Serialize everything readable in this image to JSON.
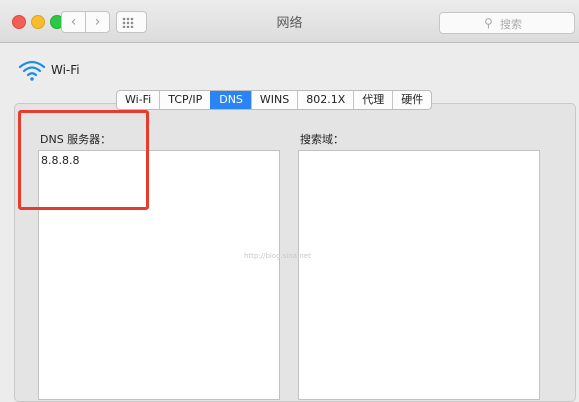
{
  "window": {
    "title": "网络"
  },
  "toolbar": {
    "back_icon": "chevron-left",
    "back_glyph": "‹",
    "forward_icon": "chevron-right",
    "forward_glyph": "›",
    "grid_icon": "grid-dots"
  },
  "search": {
    "icon": "magnifier",
    "placeholder": "搜索"
  },
  "network": {
    "icon": "wifi-icon",
    "name": "Wi-Fi"
  },
  "tabs": [
    {
      "label": "Wi-Fi"
    },
    {
      "label": "TCP/IP"
    },
    {
      "label": "DNS",
      "active": true
    },
    {
      "label": "WINS"
    },
    {
      "label": "802.1X"
    },
    {
      "label": "代理"
    },
    {
      "label": "硬件"
    }
  ],
  "dns": {
    "label": "DNS 服务器：",
    "servers": [
      "8.8.8.8"
    ]
  },
  "search_domains": {
    "label": "搜索域：",
    "items": []
  },
  "watermark": "http://blog.sina.net",
  "colors": {
    "accent": "#2b84f3",
    "highlight": "#e53c2e"
  }
}
